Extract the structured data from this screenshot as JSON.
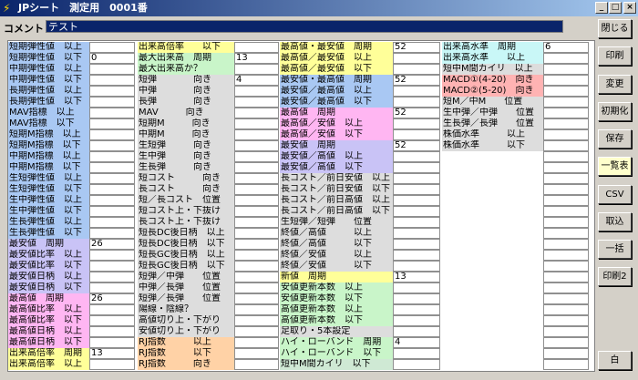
{
  "window": {
    "title": "JPシート　測定用　0001番",
    "icon": "lightning-icon",
    "minimize_glyph": "_",
    "maximize_glyph": "□",
    "close_glyph": "×"
  },
  "comment": {
    "label": "コメント",
    "value": "テスト"
  },
  "buttons": [
    {
      "name": "close-button",
      "label": "閉じる"
    },
    {
      "name": "print-button",
      "label": "印刷"
    },
    {
      "name": "change-button",
      "label": "変更"
    },
    {
      "name": "initialize-button",
      "label": "初期化"
    },
    {
      "name": "save-button",
      "label": "保存"
    },
    {
      "name": "list-table-button",
      "label": "一覧表",
      "selected": true
    },
    {
      "name": "csv-button",
      "label": "CSV"
    },
    {
      "name": "import-button",
      "label": "取込"
    },
    {
      "name": "batch-button",
      "label": "一括"
    },
    {
      "name": "print2-button",
      "label": "印刷2"
    },
    {
      "name": "white-button",
      "label": "白"
    }
  ],
  "colors": {
    "blue": "#a9c8f3",
    "yellow": "#ffff99",
    "green": "#c9f5c9",
    "orange": "#ffd2a6",
    "pink": "#ffb6f2",
    "lavender": "#c9c3f6",
    "cyan": "#c9f7f7",
    "salmon": "#ffb3b3",
    "gray": "#dddddd",
    "lightgreen": "#cfe9d4"
  },
  "columns": [
    [
      {
        "label": "短期弾性値　以上",
        "color": "blue",
        "value": ""
      },
      {
        "label": "短期弾性値　以下",
        "color": "blue",
        "value": "0"
      },
      {
        "label": "中期弾性値　以上",
        "color": "blue",
        "value": ""
      },
      {
        "label": "中期弾性値　以下",
        "color": "blue",
        "value": ""
      },
      {
        "label": "長期弾性値　以上",
        "color": "blue",
        "value": ""
      },
      {
        "label": "長期弾性値　以下",
        "color": "blue",
        "value": ""
      },
      {
        "label": "MAV指標　以上",
        "color": "blue",
        "value": ""
      },
      {
        "label": "MAV指標　以下",
        "color": "blue",
        "value": ""
      },
      {
        "label": "短期M指標　以上",
        "color": "blue",
        "value": ""
      },
      {
        "label": "短期M指標　以下",
        "color": "blue",
        "value": ""
      },
      {
        "label": "中期M指標　以上",
        "color": "blue",
        "value": ""
      },
      {
        "label": "中期M指標　以下",
        "color": "blue",
        "value": ""
      },
      {
        "label": "生短弾性値　以上",
        "color": "blue",
        "value": ""
      },
      {
        "label": "生短弾性値　以下",
        "color": "blue",
        "value": ""
      },
      {
        "label": "生中弾性値　以上",
        "color": "blue",
        "value": ""
      },
      {
        "label": "生中弾性値　以下",
        "color": "blue",
        "value": ""
      },
      {
        "label": "生長弾性値　以上",
        "color": "blue",
        "value": ""
      },
      {
        "label": "生長弾性値　以下",
        "color": "blue",
        "value": ""
      },
      {
        "label": "最安値　周期",
        "color": "lavender",
        "value": "26"
      },
      {
        "label": "最安値比率　以上",
        "color": "lavender",
        "value": ""
      },
      {
        "label": "最安値比率　以下",
        "color": "lavender",
        "value": ""
      },
      {
        "label": "最安値日柄　以上",
        "color": "lavender",
        "value": ""
      },
      {
        "label": "最安値日柄　以下",
        "color": "lavender",
        "value": ""
      },
      {
        "label": "最高値　周期",
        "color": "pink",
        "value": "26"
      },
      {
        "label": "最高値比率　以上",
        "color": "pink",
        "value": ""
      },
      {
        "label": "最高値比率　以下",
        "color": "pink",
        "value": ""
      },
      {
        "label": "最高値日柄　以上",
        "color": "pink",
        "value": ""
      },
      {
        "label": "最高値日柄　以下",
        "color": "pink",
        "value": ""
      },
      {
        "label": "出来高倍率　周期",
        "color": "yellow",
        "value": "13"
      },
      {
        "label": "出来高倍率　以上",
        "color": "yellow",
        "value": ""
      }
    ],
    [
      {
        "label": "出来高倍率　　以下",
        "color": "yellow",
        "value": ""
      },
      {
        "label": "最大出来高　周期",
        "color": "green",
        "value": "13"
      },
      {
        "label": "最大出来高か？",
        "color": "green",
        "value": ""
      },
      {
        "label": "短弾　　　　向き",
        "color": "gray",
        "value": "4"
      },
      {
        "label": "中弾　　　　向き",
        "color": "gray",
        "value": ""
      },
      {
        "label": "長弾　　　　向き",
        "color": "gray",
        "value": ""
      },
      {
        "label": "MAV　　　向き",
        "color": "gray",
        "value": ""
      },
      {
        "label": "短期M　　　向き",
        "color": "gray",
        "value": ""
      },
      {
        "label": "中期M　　　向き",
        "color": "gray",
        "value": ""
      },
      {
        "label": "生短弾　　　向き",
        "color": "gray",
        "value": ""
      },
      {
        "label": "生中弾　　　向き",
        "color": "gray",
        "value": ""
      },
      {
        "label": "生長弾　　　向き",
        "color": "gray",
        "value": ""
      },
      {
        "label": "短コスト　　　向き",
        "color": "gray",
        "value": ""
      },
      {
        "label": "長コスト　　　向き",
        "color": "gray",
        "value": ""
      },
      {
        "label": "短／長コスト　位置",
        "color": "gray",
        "value": ""
      },
      {
        "label": "短コスト上・下抜け",
        "color": "gray",
        "value": ""
      },
      {
        "label": "長コスト上・下抜け",
        "color": "gray",
        "value": ""
      },
      {
        "label": "短長DC後日柄　以上",
        "color": "gray",
        "value": ""
      },
      {
        "label": "短長DC後日柄　以下",
        "color": "gray",
        "value": ""
      },
      {
        "label": "短長GC後日柄　以上",
        "color": "gray",
        "value": ""
      },
      {
        "label": "短長GC後日柄　以下",
        "color": "gray",
        "value": ""
      },
      {
        "label": "短弾／中弾　　位置",
        "color": "gray",
        "value": ""
      },
      {
        "label": "中弾／長弾　　位置",
        "color": "gray",
        "value": ""
      },
      {
        "label": "短弾／長弾　　位置",
        "color": "gray",
        "value": ""
      },
      {
        "label": "陽線・陰線？",
        "color": "gray",
        "value": ""
      },
      {
        "label": "高値切り上・下がり",
        "color": "gray",
        "value": ""
      },
      {
        "label": "安値切り上・下がり",
        "color": "gray",
        "value": ""
      },
      {
        "label": "RJ指数　　　以上",
        "color": "orange",
        "value": ""
      },
      {
        "label": "RJ指数　　　以下",
        "color": "orange",
        "value": ""
      },
      {
        "label": "RJ指数　　　向き",
        "color": "orange",
        "value": ""
      }
    ],
    [
      {
        "label": "最高値・最安値　周期",
        "color": "yellow",
        "value": "52"
      },
      {
        "label": "最高値／最安値　以上",
        "color": "yellow",
        "value": ""
      },
      {
        "label": "最高値／最安値　以下",
        "color": "yellow",
        "value": ""
      },
      {
        "label": "最安値・最高値　周期",
        "color": "blue",
        "value": "52"
      },
      {
        "label": "最安値／最高値　以上",
        "color": "blue",
        "value": ""
      },
      {
        "label": "最安値／最高値　以下",
        "color": "blue",
        "value": ""
      },
      {
        "label": "最高値　周期",
        "color": "pink",
        "value": "52"
      },
      {
        "label": "最高値／安値　以上",
        "color": "pink",
        "value": ""
      },
      {
        "label": "最高値／安値　以下",
        "color": "pink",
        "value": ""
      },
      {
        "label": "最安値　周期",
        "color": "lavender",
        "value": "52"
      },
      {
        "label": "最安値／高値　以上",
        "color": "lavender",
        "value": ""
      },
      {
        "label": "最安値／高値　以下",
        "color": "lavender",
        "value": ""
      },
      {
        "label": "長コスト／前日安値　以上",
        "color": "gray",
        "value": ""
      },
      {
        "label": "長コスト／前日安値　以下",
        "color": "gray",
        "value": ""
      },
      {
        "label": "長コスト／前日高値　以上",
        "color": "gray",
        "value": ""
      },
      {
        "label": "長コスト／前日高値　以下",
        "color": "gray",
        "value": ""
      },
      {
        "label": "生短弾／短弾　　位置",
        "color": "gray",
        "value": ""
      },
      {
        "label": "終値／高値　　　以上",
        "color": "gray",
        "value": ""
      },
      {
        "label": "終値／高値　　　以下",
        "color": "gray",
        "value": ""
      },
      {
        "label": "終値／安値　　　以上",
        "color": "gray",
        "value": ""
      },
      {
        "label": "終値／安値　　　以下",
        "color": "gray",
        "value": ""
      },
      {
        "label": "新値　周期",
        "color": "yellow",
        "value": "13"
      },
      {
        "label": "安値更新本数　以上",
        "color": "green",
        "value": ""
      },
      {
        "label": "安値更新本数　以下",
        "color": "green",
        "value": ""
      },
      {
        "label": "高値更新本数　以上",
        "color": "green",
        "value": ""
      },
      {
        "label": "高値更新本数　以下",
        "color": "green",
        "value": ""
      },
      {
        "label": "足取り・5本設定",
        "color": "gray",
        "value": ""
      },
      {
        "label": "ハイ・ローバンド　周期",
        "color": "green",
        "value": "4"
      },
      {
        "label": "ハイ・ローバンド　以下",
        "color": "green",
        "value": ""
      },
      {
        "label": "短中M間カイリ　以下",
        "color": "lightgreen",
        "value": ""
      }
    ],
    [
      {
        "label": "出来高水準　周期",
        "color": "cyan",
        "value": "6"
      },
      {
        "label": "出来高水準　　以上",
        "color": "cyan",
        "value": ""
      },
      {
        "label": "短中M間カイリ　以上",
        "color": "gray",
        "value": ""
      },
      {
        "label": "MACD①(4-20)　向き",
        "color": "salmon",
        "value": ""
      },
      {
        "label": "MACD②(5-20)　向き",
        "color": "salmon",
        "value": ""
      },
      {
        "label": "短M／中M　　位置",
        "color": "gray",
        "value": ""
      },
      {
        "label": "生中弾／中弾　　位置",
        "color": "gray",
        "value": ""
      },
      {
        "label": "生長弾／長弾　　位置",
        "color": "gray",
        "value": ""
      },
      {
        "label": "株価水準　　　以上",
        "color": "gray",
        "value": ""
      },
      {
        "label": "株価水準　　　以下",
        "color": "gray",
        "value": ""
      },
      {
        "label": "",
        "color": "none",
        "value": ""
      },
      {
        "label": "",
        "color": "none",
        "value": ""
      },
      {
        "label": "",
        "color": "none",
        "value": ""
      },
      {
        "label": "",
        "color": "none",
        "value": ""
      },
      {
        "label": "",
        "color": "none",
        "value": ""
      },
      {
        "label": "",
        "color": "none",
        "value": ""
      },
      {
        "label": "",
        "color": "none",
        "value": ""
      },
      {
        "label": "",
        "color": "none",
        "value": ""
      },
      {
        "label": "",
        "color": "none",
        "value": ""
      },
      {
        "label": "",
        "color": "none",
        "value": ""
      },
      {
        "label": "",
        "color": "none",
        "value": ""
      },
      {
        "label": "",
        "color": "none",
        "value": ""
      },
      {
        "label": "",
        "color": "none",
        "value": ""
      },
      {
        "label": "",
        "color": "none",
        "value": ""
      },
      {
        "label": "",
        "color": "none",
        "value": ""
      },
      {
        "label": "",
        "color": "none",
        "value": ""
      },
      {
        "label": "",
        "color": "none",
        "value": ""
      },
      {
        "label": "",
        "color": "none",
        "value": ""
      },
      {
        "label": "",
        "color": "none",
        "value": ""
      },
      {
        "label": "",
        "color": "none",
        "value": ""
      }
    ]
  ]
}
